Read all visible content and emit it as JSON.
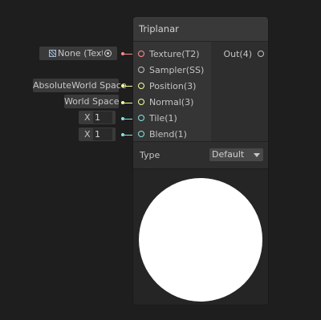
{
  "node": {
    "title": "Triplanar",
    "inputs": [
      {
        "label": "Texture(T2)",
        "color": "#ff8b8b"
      },
      {
        "label": "Sampler(SS)",
        "color": "#c0c0c0"
      },
      {
        "label": "Position(3)",
        "color": "#f6ff9a"
      },
      {
        "label": "Normal(3)",
        "color": "#f6ff9a"
      },
      {
        "label": "Tile(1)",
        "color": "#84e4e7"
      },
      {
        "label": "Blend(1)",
        "color": "#84e4e7"
      }
    ],
    "outputs": [
      {
        "label": "Out(4)",
        "color": "#c0c0c0"
      }
    ],
    "settings": {
      "type_label": "Type",
      "type_value": "Default"
    }
  },
  "fields": {
    "texture": "None (Textu",
    "position": "AbsoluteWorld Space",
    "normal": "World Space",
    "tile_axis": "X",
    "tile_value": "1",
    "blend_axis": "X",
    "blend_value": "1"
  }
}
